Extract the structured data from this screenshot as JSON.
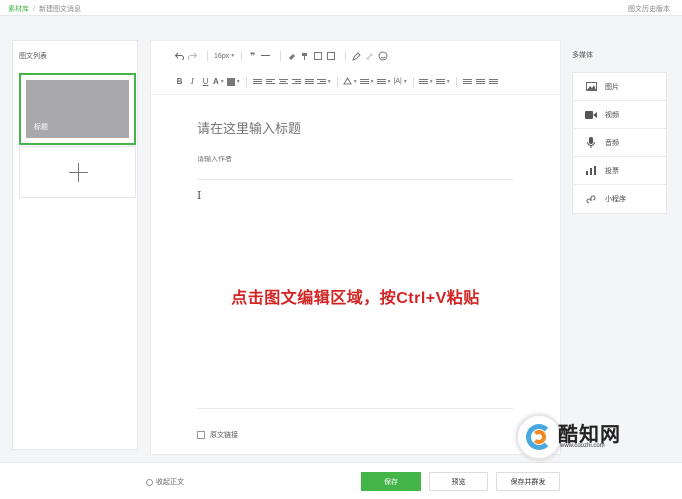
{
  "topbar": {
    "breadcrumb_root": "素材库",
    "breadcrumb_sep": "/",
    "breadcrumb_current": "新建图文消息",
    "history_link": "图文历史版本"
  },
  "left": {
    "title": "图文列表",
    "article_thumb_label": "标题"
  },
  "toolbar": {
    "font_size": "16px",
    "icons_row1": [
      "undo-icon",
      "redo-icon",
      "font-size-select",
      "quote-icon",
      "horizontal-rule-icon",
      "clear-format-icon",
      "format-painter-icon",
      "table-icon",
      "template-icon",
      "pen-icon",
      "link-icon",
      "emoji-icon"
    ],
    "icons_row2": [
      "bold",
      "italic",
      "underline",
      "font-color",
      "background-color",
      "paragraph-format",
      "align-left",
      "align-center",
      "align-right",
      "align-justify",
      "indent",
      "line-height",
      "spacing",
      "letter-spacing",
      "ordered-list",
      "unordered-list",
      "rtl",
      "ltr",
      "more"
    ]
  },
  "editor": {
    "title_placeholder": "请在这里输入标题",
    "author_placeholder": "请输入作者",
    "cursor_glyph": "I",
    "instruction": "点击图文编辑区域，按Ctrl+V粘贴",
    "original_label": "原文链接"
  },
  "right": {
    "title": "多媒体",
    "items": [
      {
        "label": "图片",
        "icon": "image-icon"
      },
      {
        "label": "视频",
        "icon": "video-icon"
      },
      {
        "label": "音频",
        "icon": "microphone-icon"
      },
      {
        "label": "投票",
        "icon": "vote-icon"
      },
      {
        "label": "小程序",
        "icon": "mini-program-icon"
      }
    ]
  },
  "footer": {
    "collapse_label": "收起正文",
    "save_label": "保存",
    "preview_label": "预览",
    "publish_label": "保存并群发"
  },
  "watermark": {
    "text": "酷知网",
    "url": "www.coozhi.com"
  },
  "colors": {
    "accent": "#44b549",
    "instruction": "#d32424"
  }
}
